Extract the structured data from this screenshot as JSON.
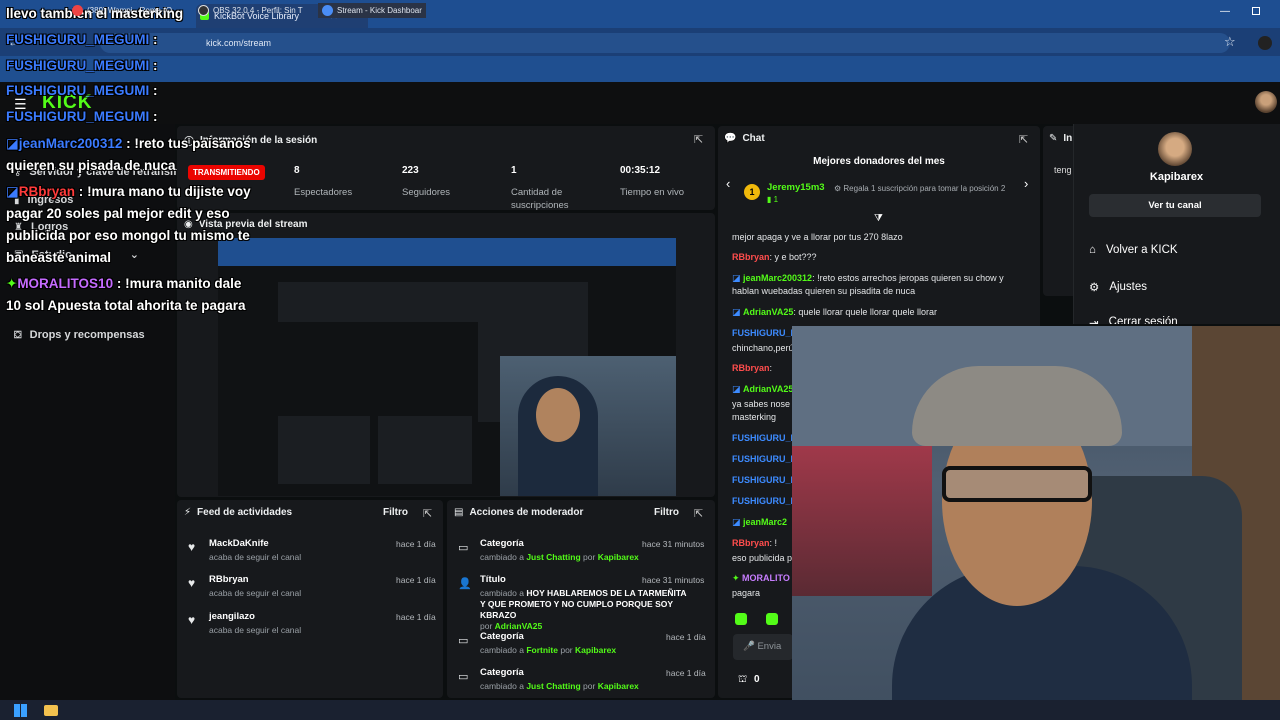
{
  "browser": {
    "tab_active_title": "KickBot Voice Library",
    "tab_new_label": "+",
    "window_title": "llevo tambien el masterking",
    "url": "kick.com/stream"
  },
  "overlay_chat": [
    {
      "user": "FUSHIGURU_MEGUMI",
      "sep": ":",
      "text": "",
      "user_color": "blue"
    },
    {
      "user": "FUSHIGURU_MEGUMI",
      "sep": ":",
      "text": "",
      "user_color": "blue"
    },
    {
      "user": "FUSHIGURU_MEGUMI",
      "sep": ":",
      "text": "",
      "user_color": "blue"
    },
    {
      "user": "jeanMarc200312",
      "sep": ":",
      "text": "!reto tus paisanos",
      "user_color": "blue"
    },
    {
      "user": "",
      "sep": "",
      "text": "quieren su pisada de nuca",
      "user_color": "white"
    },
    {
      "user": "RBbryan",
      "sep": ":",
      "text": "!mura mano tu dijiste voy",
      "user_color": "red"
    },
    {
      "user": "",
      "sep": "",
      "text": "pagar 20 soles pal mejor edit y eso",
      "user_color": "white"
    },
    {
      "user": "",
      "sep": "",
      "text": "publicida por eso mongol tu mismo te",
      "user_color": "white"
    },
    {
      "user": "",
      "sep": "",
      "text": "baneaste animal",
      "user_color": "white"
    },
    {
      "user": "MORALITOS10",
      "sep": ":",
      "text": "!mura manito dale",
      "user_color": "purple"
    },
    {
      "user": "",
      "sep": "",
      "text": "10 sol Apuesta total ahorita te pagara",
      "user_color": "white"
    }
  ],
  "sidebar": {
    "items": [
      {
        "label": "Servidor y clave de retransm",
        "icon": "key-icon"
      },
      {
        "label": "Ingresos",
        "icon": "chart-icon"
      },
      {
        "label": "Logros",
        "icon": "trophy-icon"
      },
      {
        "label": "Estudio",
        "icon": "studio-icon"
      },
      {
        "label": "Drops y recompensas",
        "icon": "gift-icon"
      }
    ]
  },
  "session": {
    "title": "Información de la sesión",
    "status": "TRANSMITIENDO",
    "stats": [
      {
        "value": "8",
        "label": "Espectadores"
      },
      {
        "value": "223",
        "label": "Seguidores"
      },
      {
        "value": "1",
        "label": "Cantidad de suscripciones"
      },
      {
        "value": "00:35:12",
        "label": "Tiempo en vivo"
      }
    ]
  },
  "preview": {
    "title": "Vista previa del stream"
  },
  "feed": {
    "title": "Feed de actividades",
    "filter_label": "Filtro",
    "items": [
      {
        "name": "MackDaKnife",
        "action": "acaba de seguir el canal",
        "time": "hace 1 día"
      },
      {
        "name": "RBbryan",
        "action": "acaba de seguir el canal",
        "time": "hace 1 día"
      },
      {
        "name": "jeangilazo",
        "action": "acaba de seguir el canal",
        "time": "hace 1 día"
      }
    ]
  },
  "mod_actions": {
    "title": "Acciones de moderador",
    "filter_label": "Filtro",
    "items": [
      {
        "type": "Categoría",
        "desc_prefix": "cambiado a",
        "value": "Just Chatting",
        "by": "por",
        "user": "Kapibarex",
        "time": "hace 31 minutos"
      },
      {
        "type": "Título",
        "desc_prefix": "cambiado a",
        "value": "HOY HABLAREMOS DE LA TARMEÑITA Y QUE PROMETO Y NO CUMPLO PORQUE SOY KBRAZO",
        "by": "por",
        "user": "AdrianVA25",
        "time": "hace 31 minutos"
      },
      {
        "type": "Categoría",
        "desc_prefix": "cambiado a",
        "value": "Fortnite",
        "by": "por",
        "user": "Kapibarex",
        "time": "hace 1 día"
      },
      {
        "type": "Categoría",
        "desc_prefix": "cambiado a",
        "value": "Just Chatting",
        "by": "por",
        "user": "Kapibarex",
        "time": "hace 1 día"
      }
    ]
  },
  "chat": {
    "title": "Chat",
    "donors_title": "Mejores donadores del mes",
    "donor_rank": "1",
    "donor_name": "Jeremy15m3",
    "donor_count": "1",
    "donor_gift_text": "Regala 1 suscripción para tomar la posición 2",
    "messages": [
      {
        "user": "",
        "text": "mejor apaga y ve a llorar por tus 270 8lazo",
        "color": "white"
      },
      {
        "user": "RBbryan",
        "text": ": y e bot???",
        "color": "red"
      },
      {
        "user": "jeanMarc200312",
        "text": ": !reto estos arrechos jeropas quieren su chow y hablan wuebadas quieren su pisadita de nuca",
        "color": "green"
      },
      {
        "user": "AdrianVA25",
        "text": ": quele llorar quele llorar quele llorar",
        "color": "green"
      },
      {
        "user": "FUSHIGURU_MEGUMI",
        "text": "",
        "color": "blue"
      },
      {
        "user": "",
        "text": "chinchano,perú",
        "color": "white"
      },
      {
        "user": "RBbryan",
        "text": ":",
        "color": "red"
      },
      {
        "user": "AdrianVA25",
        "text": "",
        "color": "green"
      },
      {
        "user": "",
        "text": "ya sabes nose",
        "color": "white"
      },
      {
        "user": "",
        "text": "masterking",
        "color": "white"
      },
      {
        "user": "FUSHIGURU_M",
        "text": "",
        "color": "blue"
      },
      {
        "user": "FUSHIGURU_M",
        "text": "",
        "color": "blue"
      },
      {
        "user": "FUSHIGURU_M",
        "text": "",
        "color": "blue"
      },
      {
        "user": "FUSHIGURU_M",
        "text": "",
        "color": "blue"
      },
      {
        "user": "jeanMarc2",
        "text": "",
        "color": "green"
      },
      {
        "user": "RBbryan",
        "text": ": !",
        "color": "red"
      },
      {
        "user": "",
        "text": "eso publicida p",
        "color": "white"
      },
      {
        "user": "MORALITO",
        "text": "",
        "color": "purple"
      },
      {
        "user": "",
        "text": "pagara",
        "color": "white"
      }
    ],
    "input_placeholder": "Envia",
    "points": "0"
  },
  "dropdown": {
    "username": "Kapibarex",
    "view_channel": "Ver tu canal",
    "items": [
      "Volver a KICK",
      "Ajustes",
      "Cerrar sesión"
    ]
  },
  "right_panel_peek": {
    "title": "In",
    "text": "teng"
  },
  "taskbar": {
    "items": [
      "(389) Wampi - Roma (O",
      "OBS 32.0.4 - Perfil: Sin T",
      "Stream - Kick Dashboar"
    ]
  },
  "colors": {
    "kick_green": "#53fc18",
    "live_red": "#eb0400",
    "browser_blue": "#1e4e91"
  }
}
